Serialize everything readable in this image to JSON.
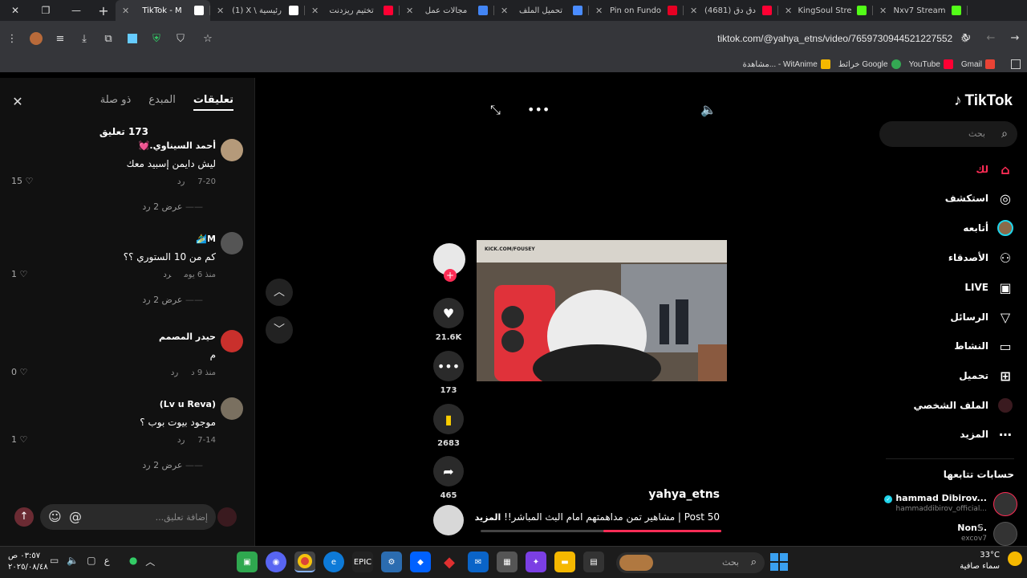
{
  "browser": {
    "tabs": [
      {
        "title": "Nxv7 Stream",
        "icon_color": "#53fc18"
      },
      {
        "title": "KingSoul Stre",
        "icon_color": "#53fc18"
      },
      {
        "title": "(4681) دق دق",
        "icon_color": "#ff0033"
      },
      {
        "title": "Pin on Fundo",
        "icon_color": "#e60023"
      },
      {
        "title": "تحميل الملف",
        "icon_color": "#4a8cff"
      },
      {
        "title": "مجالات عمل",
        "icon_color": "#4285f4"
      },
      {
        "title": "تختيم ريزدنت",
        "icon_color": "#ff0033"
      },
      {
        "title": "(1) X \\ رئيسية",
        "icon_color": "#ffffff"
      },
      {
        "title": "TikTok - M",
        "icon_color": "#ffffff",
        "active": true
      }
    ],
    "url": "tiktok.com/@yahya_etns/video/7659730944521227552",
    "bookmarks": [
      {
        "label": "Gmail",
        "icon_color": "#ea4335"
      },
      {
        "label": "YouTube",
        "icon_color": "#ff0033"
      },
      {
        "label": "خرائط Google",
        "icon_color": "#34a853"
      },
      {
        "label": "مشاهدة... - WitAnime",
        "icon_color": "#f5b800"
      }
    ]
  },
  "tiktok": {
    "logo": "TikTok",
    "search_placeholder": "بحث",
    "nav": [
      {
        "label": "لك",
        "icon": "home-icon"
      },
      {
        "label": "استكشف",
        "icon": "compass-icon"
      },
      {
        "label": "أتابعه",
        "icon": "avatar-icon"
      },
      {
        "label": "الأصدقاء",
        "icon": "friends-icon"
      },
      {
        "label": "LIVE",
        "icon": "live-icon"
      },
      {
        "label": "الرسائل",
        "icon": "send-icon"
      },
      {
        "label": "النشاط",
        "icon": "activity-icon"
      },
      {
        "label": "تحميل",
        "icon": "upload-icon"
      },
      {
        "label": "الملف الشخصي",
        "icon": "profile-icon"
      },
      {
        "label": "المزيد",
        "icon": "more-icon"
      }
    ],
    "following_title": "حسابات تتابعها",
    "following": [
      {
        "name": "hammad Dibirov...",
        "handle": "hammaddibirov_official...",
        "verified": true
      },
      {
        "name": "Non𝕊.",
        "handle": "excov7"
      }
    ]
  },
  "video": {
    "author_username": "yahya_etns",
    "description": "Post 50 | مشاهير تمن مداهمتهم امام البث المباشر!!",
    "more_label": "المزيد",
    "progress": 0.49,
    "watermark": "KICK.COM/FOUSEY",
    "likes": "21.6K",
    "comments": "173",
    "saves": "2683",
    "shares": "465"
  },
  "comments_panel": {
    "tabs": [
      "تعليقات",
      "المبدع",
      "ذو صلة"
    ],
    "count_label": "173 تعليق",
    "input_placeholder": "إضافة تعليق...",
    "reply_label": "رد",
    "items": [
      {
        "author": "أحمد السيناوي.💓",
        "text": "ليش دايمن إسبيد معك",
        "date": "7-20",
        "likes": "15",
        "replies_label": "عرض 2 رد"
      },
      {
        "author": "M🏄‍♂️",
        "text": "كم من 10 الستوري ؟؟",
        "date": "منذ 6 يوم",
        "likes": "1",
        "replies_label": "عرض 2 رد"
      },
      {
        "author": "حيدر المصمم",
        "text": "م",
        "date": "منذ 9 د",
        "likes": "0"
      },
      {
        "author": "(Lv u Reva)",
        "text": "موجود بيوت بوب ؟",
        "date": "7-14",
        "likes": "1",
        "replies_label": "عرض 2 رد"
      }
    ]
  },
  "taskbar": {
    "time": "٠٣:٥٧ ص",
    "date": "٢٠٢٥/٠٨/٤٨",
    "lang": "ع",
    "search_placeholder": "بحث",
    "weather_temp": "33°C",
    "weather_desc": "سماء صافية"
  }
}
